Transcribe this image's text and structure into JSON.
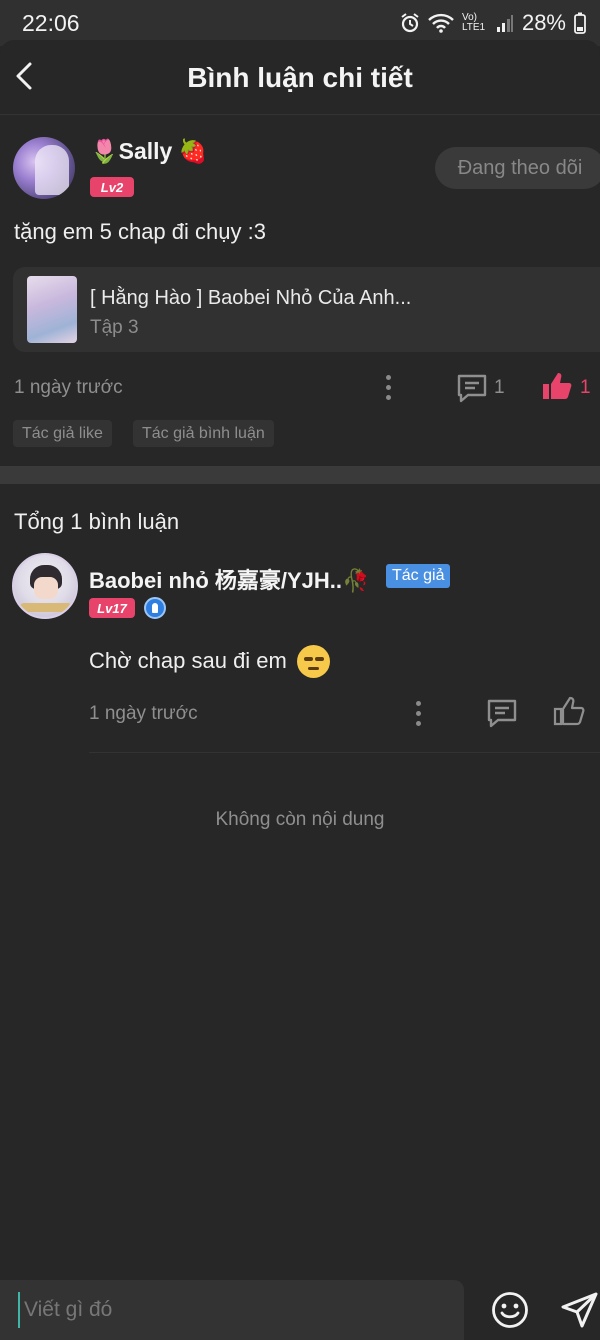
{
  "status_bar": {
    "time": "22:06",
    "battery": "28%",
    "network": "Vo) LTE1"
  },
  "header": {
    "title": "Bình luận chi tiết"
  },
  "post": {
    "username": "🌷Sally 🍓",
    "level": "Lv2",
    "follow_label": "Đang theo dõi",
    "text": "tặng em 5 chap đi chụy :3",
    "chapter": {
      "title": "[ Hằng Hào ] Baobei Nhỏ Của Anh...",
      "episode": "Tập 3"
    },
    "time": "1 ngày trước",
    "comment_count": "1",
    "like_count": "1",
    "tags": [
      "Tác giả like",
      "Tác giả bình luận"
    ]
  },
  "replies": {
    "total_label": "Tổng 1 bình luận",
    "items": [
      {
        "username": "Baobei nhỏ 杨嘉豪/YJH..🥀",
        "badge": "Tác giả",
        "level": "Lv17",
        "text": "Chờ chap sau đi em",
        "time": "1 ngày trước"
      }
    ],
    "end_label": "Không còn nội dung"
  },
  "composer": {
    "placeholder": "Viết gì đó"
  },
  "colors": {
    "background": "#272727",
    "accent_red": "#e8436a",
    "author_blue": "#4a90e2"
  }
}
